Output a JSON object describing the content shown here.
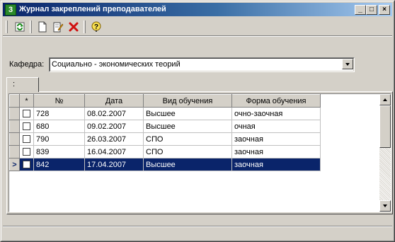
{
  "window": {
    "title": "Журнал закреплений преподавателей",
    "controls": {
      "minimize": "_",
      "maximize": "□",
      "close": "×"
    }
  },
  "toolbar": {
    "buttons": [
      {
        "name": "refresh-icon"
      },
      {
        "name": "new-document-icon"
      },
      {
        "name": "edit-icon"
      },
      {
        "name": "delete-icon"
      },
      {
        "name": "help-icon"
      }
    ]
  },
  "filter": {
    "department_label": "Кафедра:",
    "department_value": "Социально - экономических теорий"
  },
  "tab": {
    "label": ":"
  },
  "grid": {
    "columns": [
      "*",
      "№",
      "Дата",
      "Вид обучения",
      "Форма обучения"
    ],
    "rows": [
      {
        "num": "728",
        "date": "08.02.2007",
        "kind": "Высшее",
        "form": "очно-заочная",
        "selected": false
      },
      {
        "num": "680",
        "date": "09.02.2007",
        "kind": "Высшее",
        "form": "очная",
        "selected": false
      },
      {
        "num": "790",
        "date": "26.03.2007",
        "kind": "СПО",
        "form": "заочная",
        "selected": false
      },
      {
        "num": "839",
        "date": "16.04.2007",
        "kind": "СПО",
        "form": "заочная",
        "selected": false
      },
      {
        "num": "842",
        "date": "17.04.2007",
        "kind": "Высшее",
        "form": "заочная",
        "selected": true
      }
    ]
  },
  "colors": {
    "title_gradient_start": "#0a246a",
    "selection": "#0a246a",
    "face": "#d4d0c8"
  }
}
